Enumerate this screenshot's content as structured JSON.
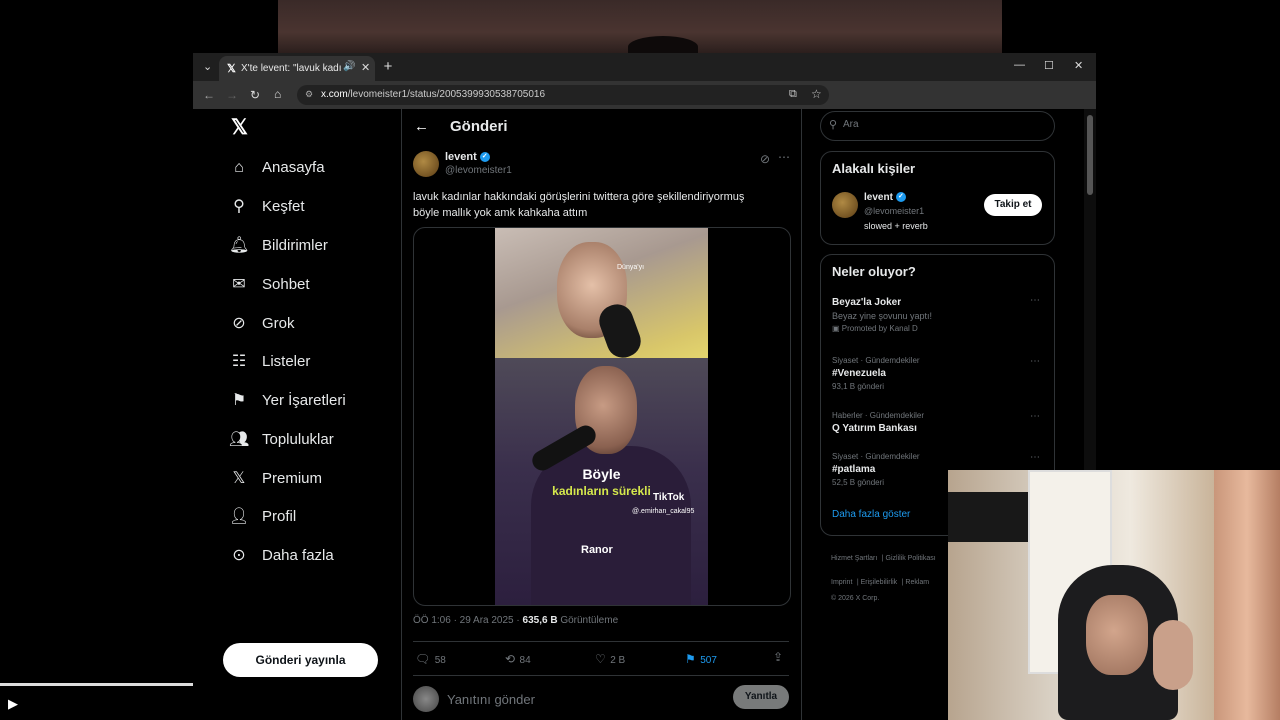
{
  "browser": {
    "tab_title": "X'te levent: \"lavuk kadınlar",
    "tab_favicon": "x-logo",
    "url_domain": "x.com",
    "url_path": "/levomeister1/status/2005399930538705016"
  },
  "nav": {
    "items": [
      {
        "label": "Anasayfa",
        "icon": "home-icon"
      },
      {
        "label": "Keşfet",
        "icon": "search-icon"
      },
      {
        "label": "Bildirimler",
        "icon": "bell-icon"
      },
      {
        "label": "Sohbet",
        "icon": "mail-icon"
      },
      {
        "label": "Grok",
        "icon": "grok-icon"
      },
      {
        "label": "Listeler",
        "icon": "list-icon"
      },
      {
        "label": "Yer İşaretleri",
        "icon": "bookmark-icon"
      },
      {
        "label": "Topluluklar",
        "icon": "communities-icon"
      },
      {
        "label": "Premium",
        "icon": "x-logo-icon"
      },
      {
        "label": "Profil",
        "icon": "person-icon"
      },
      {
        "label": "Daha fazla",
        "icon": "more-circle-icon"
      }
    ],
    "post_button": "Gönderi yayınla"
  },
  "post": {
    "header": "Gönderi",
    "author_name": "levent",
    "author_handle": "@levomeister1",
    "text_line1": "lavuk kadınlar hakkındaki görüşlerini twittera göre şekillendiriyormuş",
    "text_line2": "böyle mallık yok amk kahkaha attım",
    "video": {
      "caption_line1": "Böyle",
      "caption_line2": "kadınların sürekli",
      "watermark": "TikTok",
      "watermark_handle": "@.emirhan_cakal95",
      "brand": "Ranor",
      "tag": "Dünya'yı"
    },
    "time": "ÖÖ 1:06 · 29 Ara 2025 ·",
    "views_count": "635,6 B",
    "views_label": "Görüntüleme",
    "replies": "58",
    "reposts": "84",
    "likes": "2 B",
    "bookmarks": "507",
    "reply_placeholder": "Yanıtını gönder",
    "reply_button": "Yanıtla"
  },
  "sidebar": {
    "search_placeholder": "Ara",
    "relevant_title": "Alakalı kişiler",
    "relevant_name": "levent",
    "relevant_handle": "@levomeister1",
    "relevant_bio": "slowed + reverb",
    "follow_button": "Takip et",
    "trends_title": "Neler oluyor?",
    "trends": [
      {
        "meta": "",
        "title": "Beyaz'la Joker",
        "sub": "Beyaz yine şovunu yaptı!",
        "sub2": "Promoted by Kanal D"
      },
      {
        "meta": "Siyaset · Gündemdekiler",
        "title": "#Venezuela",
        "sub": "93,1 B gönderi",
        "sub2": ""
      },
      {
        "meta": "Haberler · Gündemdekiler",
        "title": "Q Yatırım Bankası",
        "sub": "",
        "sub2": ""
      },
      {
        "meta": "Siyaset · Gündemdekiler",
        "title": "#patlama",
        "sub": "52,5 B gönderi",
        "sub2": ""
      }
    ],
    "show_more": "Daha fazla göster",
    "footer": {
      "terms": "Hizmet Şartları",
      "privacy": "Gizlilik Politikası",
      "imprint": "Imprint",
      "accessibility": "Erişilebilirlik",
      "ads": "Reklam",
      "copyright": "© 2026 X Corp."
    }
  },
  "colors": {
    "accent": "#1d9bf0",
    "bg": "#000000",
    "border": "#2f3336",
    "muted": "#71767b"
  }
}
